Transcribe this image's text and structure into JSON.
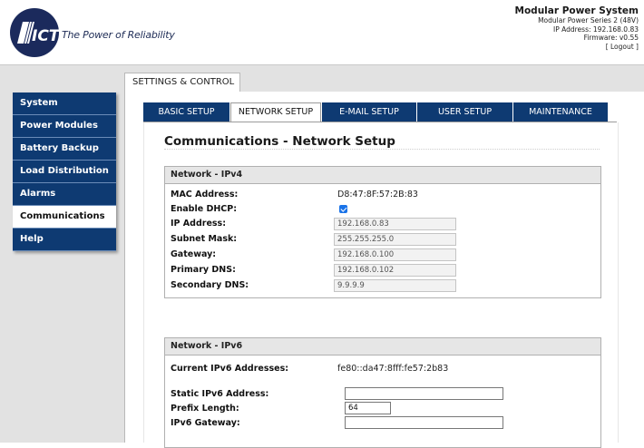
{
  "header": {
    "logo_text": "ICT",
    "tagline": "The Power of Reliability",
    "system_title": "Modular Power System",
    "system_model": "Modular Power Series 2 (48V)",
    "ip_address_line": "IP Address: 192.168.0.83",
    "firmware_line": "Firmware: v0.55",
    "logout_label": "[ Logout ]"
  },
  "top_tab": {
    "label": "SETTINGS & CONTROL"
  },
  "sidebar": {
    "items": [
      {
        "label": "System"
      },
      {
        "label": "Power Modules"
      },
      {
        "label": "Battery Backup"
      },
      {
        "label": "Load Distribution"
      },
      {
        "label": "Alarms"
      },
      {
        "label": "Communications",
        "active": true
      },
      {
        "label": "Help"
      }
    ]
  },
  "subtabs": [
    {
      "label": "BASIC SETUP"
    },
    {
      "label": "NETWORK SETUP",
      "active": true
    },
    {
      "label": "E-MAIL SETUP"
    },
    {
      "label": "USER SETUP"
    },
    {
      "label": "MAINTENANCE"
    }
  ],
  "page": {
    "title": "Communications - Network Setup"
  },
  "ipv4": {
    "heading": "Network - IPv4",
    "mac_label": "MAC Address:",
    "mac_value": "D8:47:8F:57:2B:83",
    "dhcp_label": "Enable DHCP:",
    "dhcp_checked": true,
    "ip_label": "IP Address:",
    "ip_value": "192.168.0.83",
    "subnet_label": "Subnet Mask:",
    "subnet_value": "255.255.255.0",
    "gateway_label": "Gateway:",
    "gateway_value": "192.168.0.100",
    "pdns_label": "Primary DNS:",
    "pdns_value": "192.168.0.102",
    "sdns_label": "Secondary DNS:",
    "sdns_value": "9.9.9.9"
  },
  "ipv6": {
    "heading": "Network - IPv6",
    "current_label": "Current IPv6 Addresses:",
    "current_value": "fe80::da47:8fff:fe57:2b83",
    "static_label": "Static IPv6 Address:",
    "static_value": "",
    "prefix_label": "Prefix Length:",
    "prefix_value": "64",
    "gateway_label": "IPv6 Gateway:",
    "gateway_value": ""
  },
  "colors": {
    "nav_blue": "#0e3a72",
    "checkbox_blue": "#1a73e8",
    "background_gray": "#e2e2e2"
  }
}
